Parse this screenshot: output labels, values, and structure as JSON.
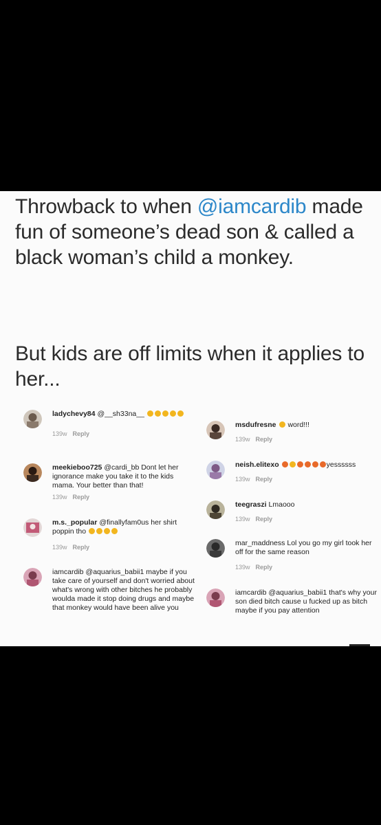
{
  "headline": {
    "part1": "Throwback to when ",
    "mention": "@iamcardib",
    "part2": " made fun of someone’s dead son & called a black woman’s child a monkey."
  },
  "subline": "But kids are off limits when it applies to her...",
  "colors": {
    "mention": "#2c87c9",
    "text": "#2b2b2b",
    "card_bg": "#fbfbfb",
    "page_bg": "#000000"
  },
  "comments_left": [
    {
      "username": "ladychevy84",
      "text": "@__sh33na__",
      "emoji_count": 5,
      "time": "139w",
      "reply": "Reply"
    },
    {
      "username": "meekieboo725",
      "text": "@cardi_bb Dont let her ignorance make you take it to the kids mama. Your better than that!",
      "time": "139w",
      "reply": "Reply"
    },
    {
      "username": "m.s._popular",
      "text": "@finallyfam0us her shirt poppin tho",
      "emoji_count": 4,
      "time": "139w",
      "reply": "Reply"
    },
    {
      "username": "iamcardib",
      "text": "@aquarius_babii1 maybe if you take care of yourself and don't worried about what's wrong with other bitches he probably woulda made it stop doing drugs and maybe that monkey would have been alive you"
    }
  ],
  "comments_right": [
    {
      "username": "msdufresne",
      "text": "word!!!",
      "emoji_count": 1,
      "time": "139w",
      "reply": "Reply"
    },
    {
      "username": "neish.elitexo",
      "text": "yessssss",
      "emoji_count": 6,
      "time": "139w",
      "reply": "Reply"
    },
    {
      "username": "teegraszi",
      "text": "Lmaooo",
      "time": "139w",
      "reply": "Reply"
    },
    {
      "username": "mar_maddness",
      "text": "Lol you go my girl took her off for the same reason",
      "time": "139w",
      "reply": "Reply"
    },
    {
      "username": "iamcardib",
      "text": "@aquarius_babii1 that's why your son died bitch cause u fucked up as bitch maybe if you pay attention"
    }
  ]
}
